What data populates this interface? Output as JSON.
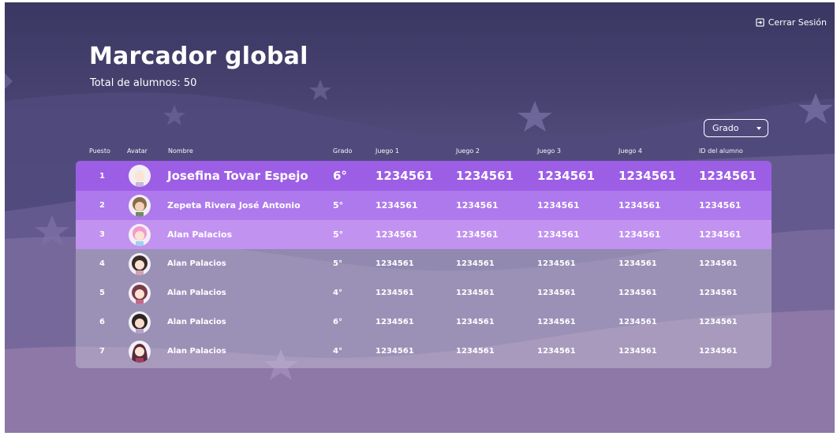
{
  "header": {
    "logout_label": "Cerrar Sesión",
    "title": "Marcador global",
    "total_label": "Total de alumnos: 50"
  },
  "filter": {
    "grado_label": "Grado"
  },
  "table": {
    "columns": [
      "Puesto",
      "Avatar",
      "Nombre",
      "Grado",
      "Juego 1",
      "Juego 2",
      "Juego 3",
      "Juego 4",
      "ID del alumno"
    ],
    "rows": [
      {
        "puesto": "1",
        "avatar": "white-hair-avatar",
        "nombre": "Josefina Tovar Espejo",
        "grado": "6°",
        "juego1": "1234561",
        "juego2": "1234561",
        "juego3": "1234561",
        "juego4": "1234561",
        "id": "1234561"
      },
      {
        "puesto": "2",
        "avatar": "brown-hair-avatar",
        "nombre": "Zepeta Rivera José Antonio",
        "grado": "5°",
        "juego1": "1234561",
        "juego2": "1234561",
        "juego3": "1234561",
        "juego4": "1234561",
        "id": "1234561"
      },
      {
        "puesto": "3",
        "avatar": "pink-hair-avatar",
        "nombre": "Alan Palacios",
        "grado": "5°",
        "juego1": "1234561",
        "juego2": "1234561",
        "juego3": "1234561",
        "juego4": "1234561",
        "id": "1234561"
      },
      {
        "puesto": "4",
        "avatar": "dark-hair-avatar",
        "nombre": "Alan Palacios",
        "grado": "5°",
        "juego1": "1234561",
        "juego2": "1234561",
        "juego3": "1234561",
        "juego4": "1234561",
        "id": "1234561"
      },
      {
        "puesto": "5",
        "avatar": "auburn-hair-avatar",
        "nombre": "Alan Palacios",
        "grado": "4°",
        "juego1": "1234561",
        "juego2": "1234561",
        "juego3": "1234561",
        "juego4": "1234561",
        "id": "1234561"
      },
      {
        "puesto": "6",
        "avatar": "dark-hair-avatar",
        "nombre": "Alan Palacios",
        "grado": "6°",
        "juego1": "1234561",
        "juego2": "1234561",
        "juego3": "1234561",
        "juego4": "1234561",
        "id": "1234561"
      },
      {
        "puesto": "7",
        "avatar": "long-hair-avatar",
        "nombre": "Alan Palacios",
        "grado": "4°",
        "juego1": "1234561",
        "juego2": "1234561",
        "juego3": "1234561",
        "juego4": "1234561",
        "id": "1234561"
      }
    ]
  },
  "colors": {
    "background_top": "#3b3763",
    "background_bottom": "#8e76a6",
    "row_first": "#9d5ee6",
    "row_second": "#ad79ec",
    "row_third": "#c192ef"
  }
}
